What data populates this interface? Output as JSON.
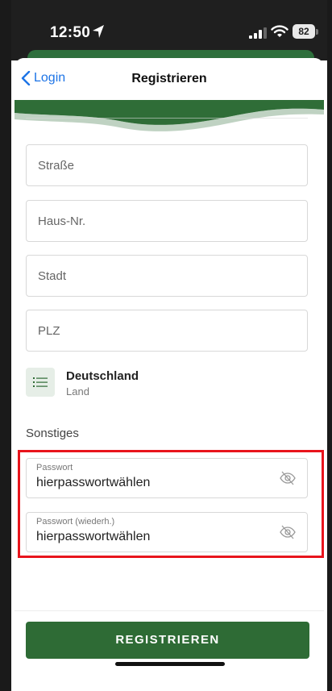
{
  "status_bar": {
    "time": "12:50",
    "battery": "82"
  },
  "nav": {
    "back_label": "Login",
    "title": "Registrieren"
  },
  "fields": {
    "street_placeholder": "Straße",
    "house_placeholder": "Haus-Nr.",
    "city_placeholder": "Stadt",
    "zip_placeholder": "PLZ"
  },
  "country": {
    "name": "Deutschland",
    "label": "Land"
  },
  "section_title": "Sonstiges",
  "password": {
    "label": "Passwort",
    "value": "hierpasswortwählen"
  },
  "password_repeat": {
    "label": "Passwort (wiederh.)",
    "value": "hierpasswortwählen"
  },
  "register_button": "REGISTRIEREN",
  "colors": {
    "brand_green": "#2e6b35",
    "link_blue": "#1d74e6",
    "highlight_red": "#e8141c"
  }
}
